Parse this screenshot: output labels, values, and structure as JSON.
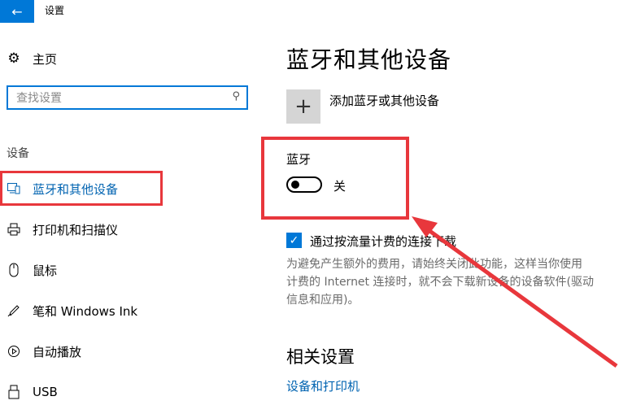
{
  "window": {
    "title": "设置",
    "back_icon": "arrow-left-icon",
    "accent": "#0078d7"
  },
  "sidebar": {
    "home_label": "主页",
    "search_placeholder": "查找设置",
    "section_label": "设备",
    "items": [
      {
        "label": "蓝牙和其他设备",
        "icon": "bluetooth-devices-icon",
        "active": true
      },
      {
        "label": "打印机和扫描仪",
        "icon": "printer-icon",
        "active": false
      },
      {
        "label": "鼠标",
        "icon": "mouse-icon",
        "active": false
      },
      {
        "label": "笔和 Windows Ink",
        "icon": "pen-icon",
        "active": false
      },
      {
        "label": "自动播放",
        "icon": "autoplay-icon",
        "active": false
      },
      {
        "label": "USB",
        "icon": "usb-icon",
        "active": false
      }
    ]
  },
  "main": {
    "title": "蓝牙和其他设备",
    "add_device_label": "添加蓝牙或其他设备",
    "bluetooth": {
      "label": "蓝牙",
      "state": "关",
      "on": false
    },
    "metered": {
      "checked": true,
      "label": "通过按流量计费的连接下载",
      "description": [
        "为避免产生额外的费用，请始终关闭此功能，这样当你使用",
        "计费的 Internet 连接时，就不会下载新设备的设备软件(驱动",
        "信息和应用)。"
      ]
    },
    "related_title": "相关设置",
    "related_link": "设备和打印机"
  },
  "annotation_color": "#e8373c"
}
